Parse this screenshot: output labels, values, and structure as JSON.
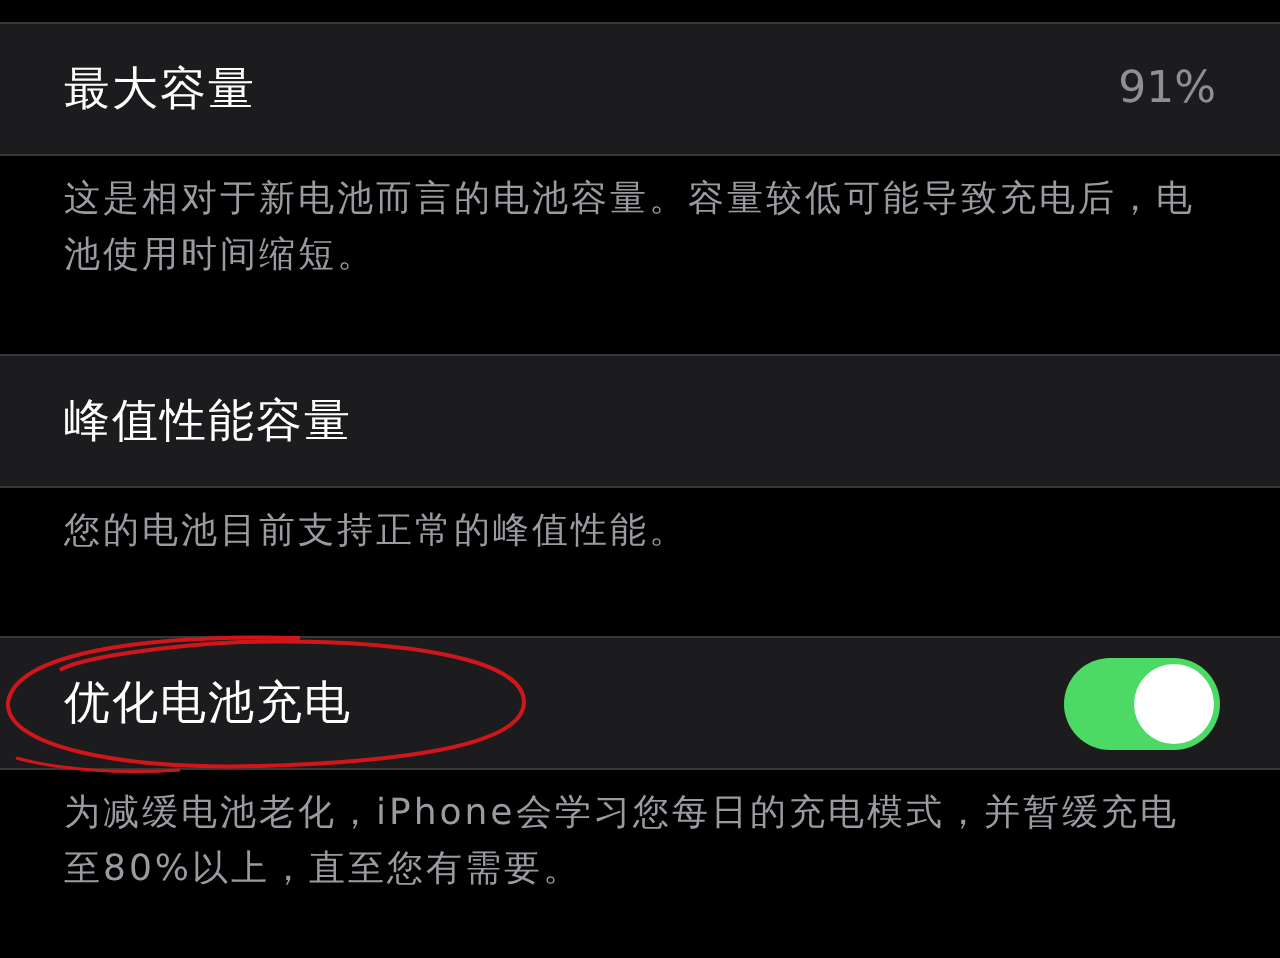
{
  "sections": [
    {
      "row": {
        "kind": "value",
        "label": "最大容量",
        "value": "91%"
      },
      "footer": "这是相对于新电池而言的电池容量。容量较低可能导致充电后，电池使用时间缩短。"
    },
    {
      "row": {
        "kind": "plain",
        "label": "峰值性能容量"
      },
      "footer": "您的电池目前支持正常的峰值性能。"
    },
    {
      "row": {
        "kind": "toggle",
        "label": "优化电池充电",
        "on": true,
        "circled": true
      },
      "footer": "为减缓电池老化，iPhone会学习您每日的充电模式，并暂缓充电至80%以上，直至您有需要。"
    }
  ]
}
